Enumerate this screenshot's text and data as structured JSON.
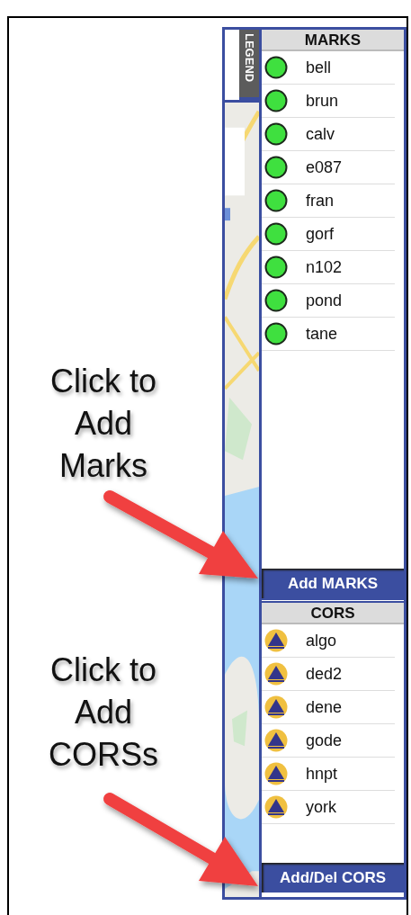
{
  "annotations": [
    {
      "lines": [
        "Click to",
        "Add",
        "Marks"
      ]
    },
    {
      "lines": [
        "Click to",
        "Add",
        "CORSs"
      ]
    }
  ],
  "legend_tab": {
    "label": "LEGEND"
  },
  "sections": [
    {
      "kind": "marks",
      "title": "MARKS",
      "button": "Add MARKS",
      "items": [
        {
          "label": "bell"
        },
        {
          "label": "brun"
        },
        {
          "label": "calv"
        },
        {
          "label": "e087"
        },
        {
          "label": "fran"
        },
        {
          "label": "gorf"
        },
        {
          "label": "n102"
        },
        {
          "label": "pond"
        },
        {
          "label": "tane"
        }
      ]
    },
    {
      "kind": "cors",
      "title": "CORS",
      "button": "Add/Del CORS",
      "items": [
        {
          "label": "algo"
        },
        {
          "label": "ded2"
        },
        {
          "label": "dene"
        },
        {
          "label": "gode"
        },
        {
          "label": "hnpt"
        },
        {
          "label": "york"
        }
      ]
    }
  ]
}
